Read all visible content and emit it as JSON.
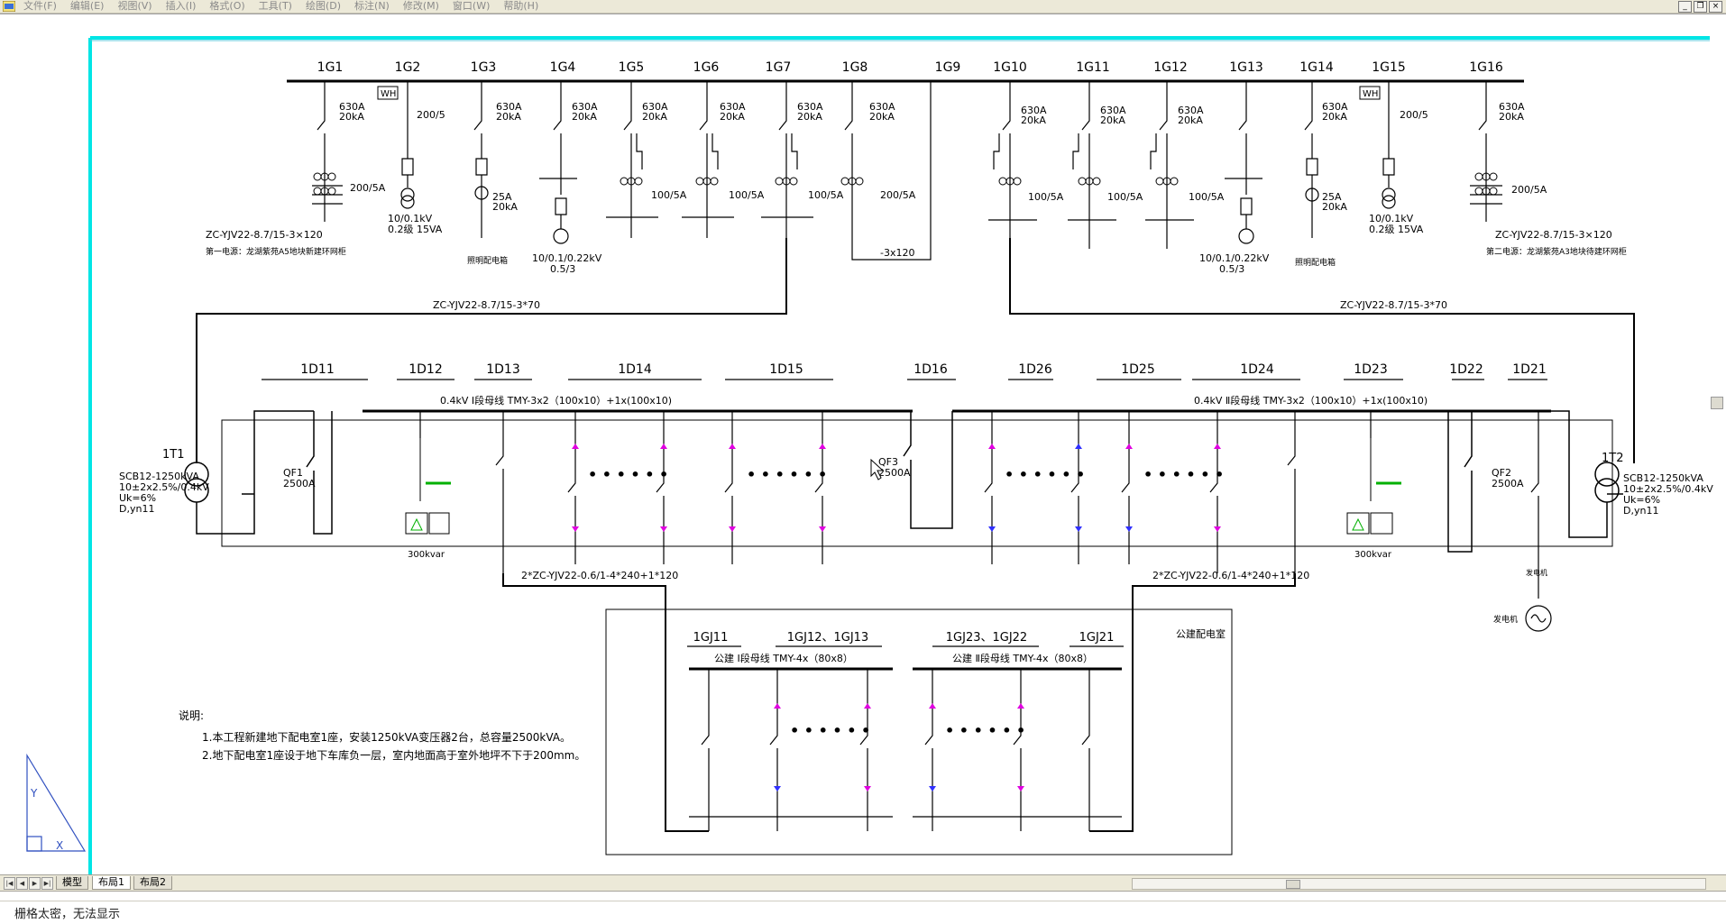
{
  "menubar": {
    "items": [
      "文件(F)",
      "编辑(E)",
      "视图(V)",
      "插入(I)",
      "格式(O)",
      "工具(T)",
      "绘图(D)",
      "标注(N)",
      "修改(M)",
      "窗口(W)",
      "帮助(H)"
    ]
  },
  "colors": {
    "frame": "#00e5e5",
    "line": "#000000",
    "pink": "#e000e0",
    "blue": "#3030ff",
    "green": "#00b000",
    "bar_bg": "#ece9d8"
  },
  "drawing": {
    "top_panels": [
      "1G1",
      "1G2",
      "1G3",
      "1G4",
      "1G5",
      "1G6",
      "1G7",
      "1G8",
      "1G9",
      "1G10",
      "1G11",
      "1G12",
      "1G13",
      "1G14",
      "1G15",
      "1G16"
    ],
    "ratings": {
      "630A": "630A",
      "20kA": "20kA",
      "200_5A": "200/5A",
      "100_5A": "100/5A",
      "200_5": "200/5",
      "25A": "25A",
      "wh": "WH",
      "pt_left": "10/0.1kV",
      "pt_left2": "0.2级 15VA",
      "pt_mid": "10/0.1/0.22kV",
      "pt_mid2": "0.5/3",
      "lighting": "照明配电箱",
      "cable_3x120": "-3x120"
    },
    "incoming_left_cable": "ZC-YJV22-8.7/15-3×120",
    "incoming_left_note": "第一电源：龙湖紫苑A5地块新建环网柜",
    "incoming_right_cable": "ZC-YJV22-8.7/15-3×120",
    "incoming_right_note": "第二电源：龙湖紫苑A3地块待建环网柜",
    "hv_cable_left": "ZC-YJV22-8.7/15-3*70",
    "hv_cable_right": "ZC-YJV22-8.7/15-3*70",
    "lv_panels": [
      "1D11",
      "1D12",
      "1D13",
      "1D14",
      "1D15",
      "1D16",
      "1D26",
      "1D25",
      "1D24",
      "1D23",
      "1D22",
      "1D21"
    ],
    "bus1_label": "0.4kV Ⅰ段母线  TMY-3x2（100x10）+1x(100x10)",
    "bus2_label": "0.4kV Ⅱ段母线  TMY-3x2（100x10）+1x(100x10)",
    "transformers": {
      "t1_name": "1T1",
      "t1_spec": "SCB12-1250kVA",
      "t1_ratio": "10±2x2.5%/0.4kV",
      "t1_uk": "Uk=6%",
      "t1_group": "D,yn11",
      "t2_name": "1T2",
      "t2_spec": "SCB12-1250kVA",
      "t2_ratio": "10±2x2.5%/0.4kV",
      "t2_uk": "Uk=6%",
      "t2_group": "D,yn11"
    },
    "breakers": {
      "qf1": "QF1",
      "qf1_rating": "2500A",
      "qf2": "QF2",
      "qf2_rating": "2500A",
      "qf3": "QF3",
      "qf3_rating": "2500A"
    },
    "capacitor_left": "300kvar",
    "capacitor_right": "300kvar",
    "generator_label": "发电机",
    "generator_cable_label": "发电机",
    "lv_cable_left": "2*ZC-YJV22-0.6/1-4*240+1*120",
    "lv_cable_right": "2*ZC-YJV22-0.6/1-4*240+1*120",
    "public_room": {
      "title": "公建配电室",
      "panels": [
        "1GJ11",
        "1GJ12、1GJ13",
        "1GJ23、1GJ22",
        "1GJ21"
      ],
      "bus1": "公建 Ⅰ段母线   TMY-4x（80x8）",
      "bus2": "公建 Ⅱ段母线   TMY-4x（80x8）"
    },
    "notes": {
      "title": "说明:",
      "line1": "1.本工程新建地下配电室1座，安装1250kVA变压器2台，总容量2500kVA。",
      "line2": "2.地下配电室1座设于地下车库负一层，室内地面高于室外地坪不下于200mm。"
    },
    "ucs": {
      "x": "X",
      "y": "Y"
    }
  },
  "tabs": {
    "items": [
      "模型",
      "布局1",
      "布局2"
    ],
    "active": "布局1"
  },
  "status": {
    "command_text": "栅格太密，无法显示"
  }
}
